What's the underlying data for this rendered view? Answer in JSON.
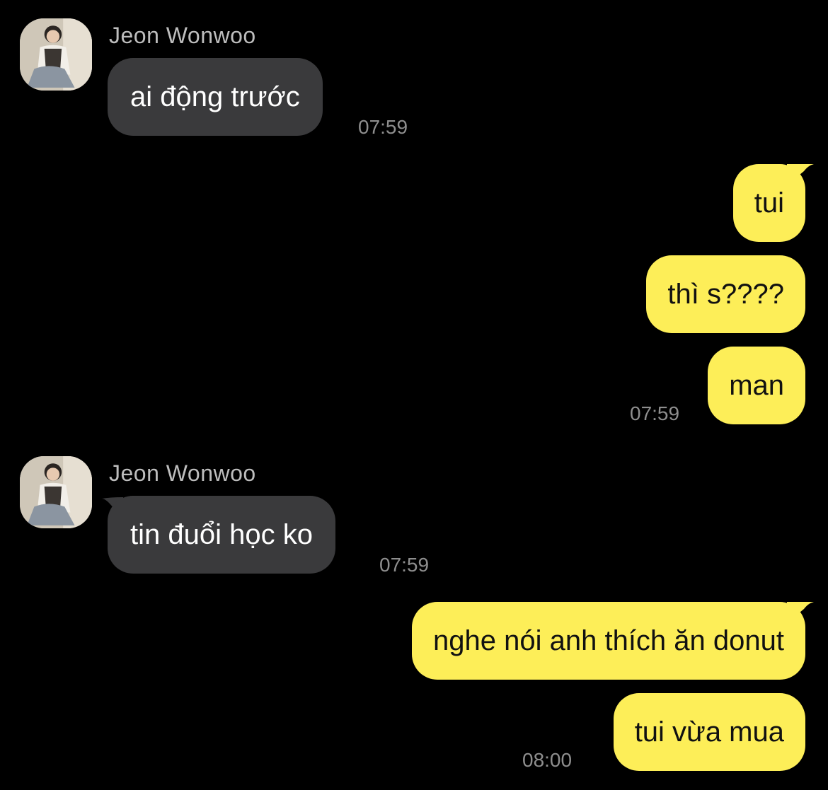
{
  "colors": {
    "background": "#000000",
    "incoming_bubble": "#3a3a3c",
    "outgoing_bubble": "#fdee58",
    "sender_name": "#bdbdbd",
    "timestamp": "#8e8e8e"
  },
  "groups": [
    {
      "sender": "Jeon Wonwoo",
      "avatar_icon": "profile-photo",
      "messages": [
        {
          "text": "ai động trước"
        }
      ],
      "time": "07:59"
    },
    {
      "sender": "me",
      "messages": [
        {
          "text": "tui"
        },
        {
          "text": "thì s????"
        },
        {
          "text": "man"
        }
      ],
      "time": "07:59"
    },
    {
      "sender": "Jeon Wonwoo",
      "avatar_icon": "profile-photo",
      "messages": [
        {
          "text": "tin đuổi học ko"
        }
      ],
      "time": "07:59"
    },
    {
      "sender": "me",
      "messages": [
        {
          "text": "nghe nói anh thích ăn donut"
        },
        {
          "text": "tui vừa mua"
        }
      ],
      "time": "08:00"
    }
  ]
}
